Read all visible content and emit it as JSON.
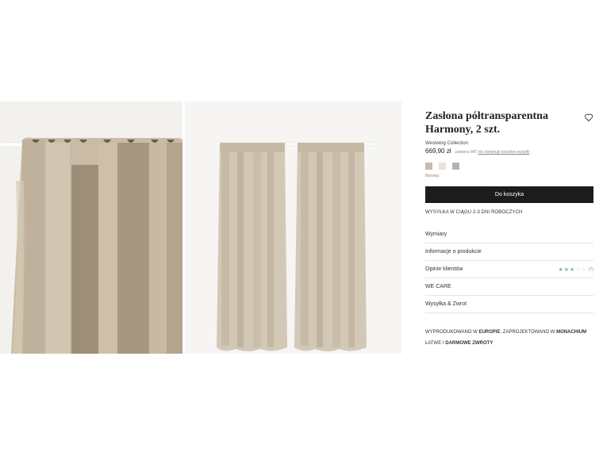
{
  "product": {
    "title": "Zasłona półtransparentna Harmony, 2 szt.",
    "brand": "Westwing Collection",
    "price": "669,90 zł",
    "vat_note": "zawiera VAT",
    "shipping_link": "nie obejmuje kosztów wysyłki",
    "selected_color": "Beżowy",
    "swatches": [
      {
        "name": "bezowy",
        "color": "#c9bcad"
      },
      {
        "name": "kremowy",
        "color": "#ece3d6"
      },
      {
        "name": "szary",
        "color": "#b3b3b3"
      }
    ]
  },
  "cart_button": "Do koszyka",
  "shipping_info": "WYSYŁKA W CIĄGU 2-3 DNI ROBOCZYCH",
  "accordion": {
    "dimensions": "Wymiary",
    "product_info": "Informacje o produkcie",
    "reviews": "Opinie klientów",
    "we_care": "WE CARE",
    "shipping_returns": "Wysyłka & Zwrot"
  },
  "reviews": {
    "rating": 3,
    "max": 5,
    "count": "(7)"
  },
  "notes": {
    "line1_a": "WYPRODUKOWANO W ",
    "line1_b": "EUROPIE",
    "line1_c": ", ZAPROJEKTOWANO W ",
    "line1_d": "MONACHIUM",
    "line2_a": "ŁATWE I ",
    "line2_b": "DARMOWE ZWROTY"
  },
  "colors": {
    "button_bg": "#1c1c1c",
    "star": "#7ab9a3",
    "linen": "#c8baa5"
  }
}
